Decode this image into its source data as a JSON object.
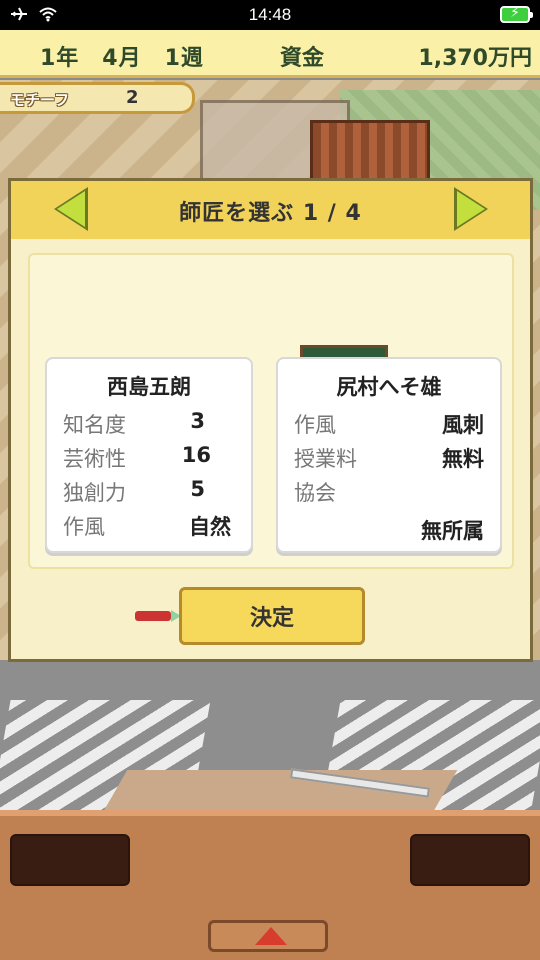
{
  "status_bar": {
    "time": "14:48"
  },
  "top_bar": {
    "date": "1年　4月　1週",
    "funds_label": "資金",
    "funds_value": "1,370万円"
  },
  "motif": {
    "label": "モチーフ",
    "count": "2"
  },
  "dialog": {
    "title": "師匠を選ぶ 1 / 4",
    "mentors": [
      {
        "name": "西島五朗",
        "rows": [
          {
            "k": "知名度",
            "v": "3"
          },
          {
            "k": "芸術性",
            "v": "16"
          },
          {
            "k": "独創力",
            "v": "5"
          },
          {
            "k": "作風",
            "v": "自然"
          }
        ]
      },
      {
        "name": "尻村へそ雄",
        "rows": [
          {
            "k": "作風",
            "v": "風刺"
          },
          {
            "k": "授業料",
            "v": "無料"
          },
          {
            "k": "協会",
            "v": ""
          },
          {
            "k": "",
            "v": "無所属"
          }
        ]
      }
    ],
    "confirm_label": "決定"
  },
  "colors": {
    "header_yellow": "#f1d35a",
    "arrow_green": "#c3df3e",
    "panel_cream": "#fbf6d6"
  }
}
